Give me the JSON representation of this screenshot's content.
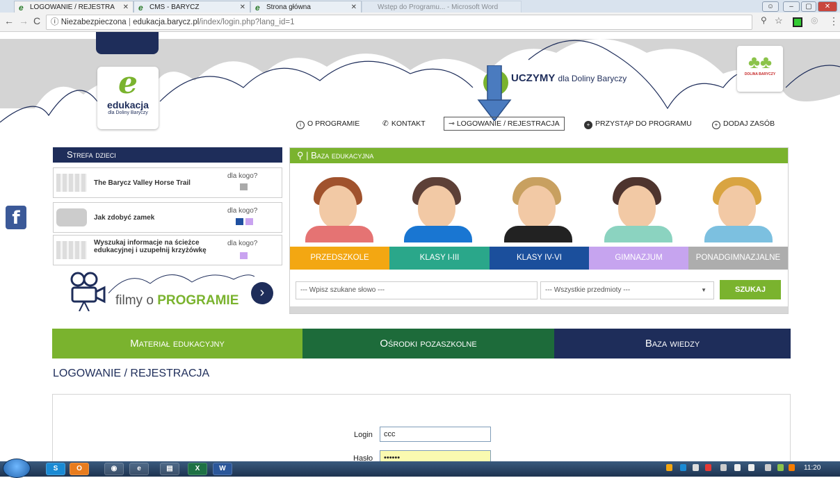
{
  "browser": {
    "tabs": [
      {
        "label": "LOGOWANIE / REJESTRA"
      },
      {
        "label": "CMS - BARYCZ"
      },
      {
        "label": "Strona główna"
      },
      {
        "label": "Wstęp do Programu... - Microsoft Word"
      }
    ],
    "address_security": "Niezabezpieczona",
    "address_host": "edukacja.barycz.pl",
    "address_path": "/index/login.php?lang_id=1"
  },
  "header": {
    "logo_title": "edukacja",
    "logo_subtitle": "dla Doliny Baryczy",
    "slogan_bold": "UCZYMY",
    "slogan_rest": "dla Doliny Baryczy",
    "right_logo_text": "DOLINA BARYCZY"
  },
  "topnav": {
    "o_programie": "O PROGRAMIE",
    "kontakt": "KONTAKT",
    "logowanie": "LOGOWANIE / REJESTRACJA",
    "przystap": "PRZYSTĄP DO PROGRAMU",
    "dodaj": "DODAJ ZASÓB"
  },
  "strefa": {
    "title": "Strefa dzieci",
    "items": [
      {
        "title": "The Barycz Valley Horse Trail",
        "dla": "dla kogo?"
      },
      {
        "title": "Jak zdobyć zamek",
        "dla": "dla kogo?"
      },
      {
        "title": "Wyszukaj informacje na ścieżce edukacyjnej i uzupełnij krzyżówkę",
        "dla": "dla kogo?"
      }
    ],
    "filmy_prefix": "filmy o",
    "filmy_bold": "PROGRAMIE"
  },
  "baza": {
    "title": "Baza edukacyjna",
    "categories": [
      "PRZEDSZKOLE",
      "KLASY I-III",
      "KLASY IV-VI",
      "GIMNAZJUM",
      "PONADGIMNAZJALNE"
    ],
    "search_placeholder": "--- Wpisz szukane słowo ---",
    "subject_selected": "--- Wszystkie przedmioty ---",
    "search_button": "SZUKAJ"
  },
  "bignav": {
    "material": "Materiał edukacyjny",
    "osrodki": "Ośrodki pozaszkolne",
    "baza_wiedzy": "Baza wiedzy"
  },
  "login": {
    "section_title": "LOGOWANIE / REJESTRACJA",
    "login_label": "Login",
    "login_value": "ccc",
    "password_label": "Hasło",
    "password_value": "••••••"
  },
  "taskbar": {
    "clock": "11:20"
  },
  "colors": {
    "green": "#7ab32e",
    "navy": "#1e2d5a",
    "darkgreen": "#1d6b3a"
  }
}
